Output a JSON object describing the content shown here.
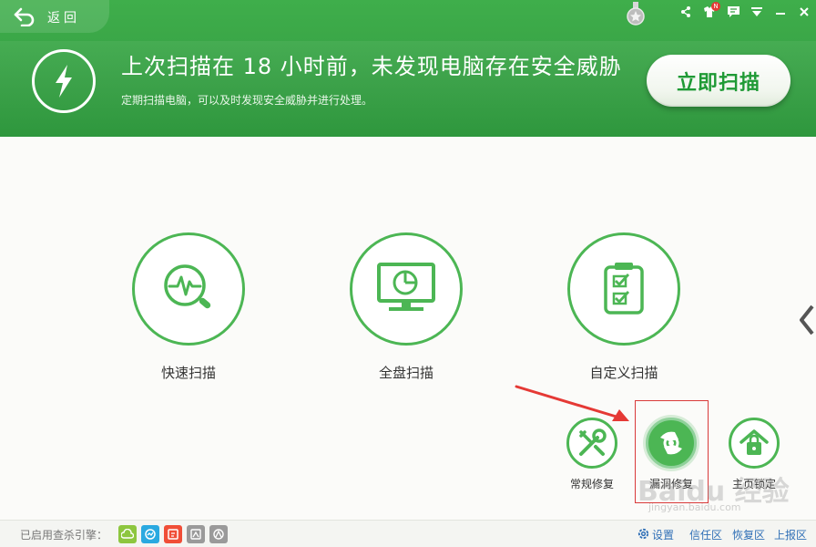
{
  "header": {
    "back_label": "返回",
    "title": "上次扫描在 18 小时前，未发现电脑存在安全威胁",
    "subtitle": "定期扫描电脑，可以及时发现安全威胁并进行处理。",
    "scan_button": "立即扫描",
    "titlebar_icons": [
      "medal-icon",
      "share-icon",
      "skin-icon",
      "feedback-icon",
      "menu-icon",
      "minimize-icon",
      "close-icon"
    ],
    "notification_badge": "N"
  },
  "actions": [
    {
      "label": "快速扫描",
      "icon": "quick-scan-icon"
    },
    {
      "label": "全盘扫描",
      "icon": "full-scan-icon"
    },
    {
      "label": "自定义扫描",
      "icon": "custom-scan-icon"
    }
  ],
  "tools": [
    {
      "label": "常规修复",
      "icon": "wrench-icon"
    },
    {
      "label": "漏洞修复",
      "icon": "patch-icon"
    },
    {
      "label": "主页锁定",
      "icon": "lock-home-icon"
    }
  ],
  "footer": {
    "engines_label": "已启用查杀引擎：",
    "engines": [
      "cloud-engine-icon",
      "qvm-engine-icon",
      "qex-engine-icon",
      "bitdefender-engine-icon",
      "avira-engine-icon"
    ],
    "settings": "设置",
    "trust_zone": "信任区",
    "restore_zone": "恢复区",
    "report_zone": "上报区"
  },
  "watermark": {
    "text": "Baidu 经验",
    "sub": "jingyan.baidu.com"
  },
  "colors": {
    "brand_green": "#36a044",
    "accent_green": "#4cb654",
    "button_text": "#1f9a35",
    "link_blue": "#2f6fb6",
    "annotation_red": "#d93a3a"
  }
}
